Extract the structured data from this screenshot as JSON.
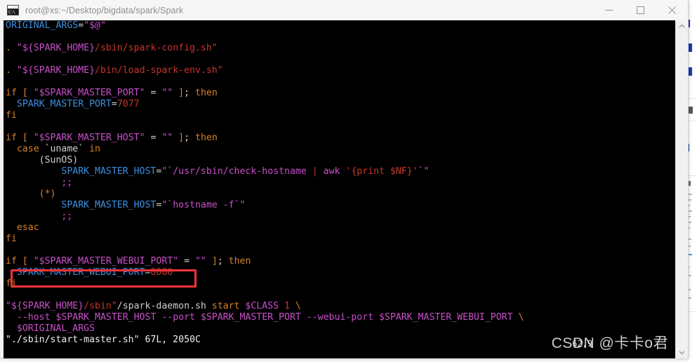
{
  "window": {
    "title": "root@xs:~/Desktop/bigdata/spark/Spark",
    "icon": "console-icon",
    "icon_text": "C:\\",
    "controls": [
      {
        "name": "minimize",
        "glyph": "minimize-icon"
      },
      {
        "name": "maximize",
        "glyph": "maximize-icon"
      },
      {
        "name": "close",
        "glyph": "close-icon"
      }
    ]
  },
  "terminal": {
    "background": "#000000",
    "editor": "vim",
    "colors": {
      "keyword": "#d8822a",
      "variable": "#c850c8",
      "string": "#c8352c",
      "identifier": "#3c8fe0",
      "plain": "#d0d0d0",
      "annotation": "#f5333a"
    },
    "lines": [
      [
        {
          "t": "ORIGINAL_ARGS",
          "c": "c-id"
        },
        {
          "t": "=",
          "c": "c-plain"
        },
        {
          "t": "\"$@\"",
          "c": "c-var"
        }
      ],
      [],
      [
        {
          "t": ". ",
          "c": "c-kw"
        },
        {
          "t": "\"${SPARK_HOME}",
          "c": "c-var"
        },
        {
          "t": "/sbin/spark-config.sh\"",
          "c": "c-str"
        }
      ],
      [],
      [
        {
          "t": ". ",
          "c": "c-kw"
        },
        {
          "t": "\"${SPARK_HOME}",
          "c": "c-var"
        },
        {
          "t": "/bin/load-spark-env.sh\"",
          "c": "c-str"
        }
      ],
      [],
      [
        {
          "t": "if ",
          "c": "c-kw"
        },
        {
          "t": "[ ",
          "c": "c-kw"
        },
        {
          "t": "\"$SPARK_MASTER_PORT\"",
          "c": "c-var"
        },
        {
          "t": " = ",
          "c": "c-plain"
        },
        {
          "t": "\"\"",
          "c": "c-var"
        },
        {
          "t": " ]",
          "c": "c-kw"
        },
        {
          "t": "; ",
          "c": "c-plain"
        },
        {
          "t": "then",
          "c": "c-kw"
        }
      ],
      [
        {
          "t": "  SPARK_MASTER_PORT",
          "c": "c-id"
        },
        {
          "t": "=",
          "c": "c-plain"
        },
        {
          "t": "7077",
          "c": "c-num"
        }
      ],
      [
        {
          "t": "fi",
          "c": "c-kw"
        }
      ],
      [],
      [
        {
          "t": "if ",
          "c": "c-kw"
        },
        {
          "t": "[ ",
          "c": "c-kw"
        },
        {
          "t": "\"$SPARK_MASTER_HOST\"",
          "c": "c-var"
        },
        {
          "t": " = ",
          "c": "c-plain"
        },
        {
          "t": "\"\"",
          "c": "c-var"
        },
        {
          "t": " ]",
          "c": "c-kw"
        },
        {
          "t": "; ",
          "c": "c-plain"
        },
        {
          "t": "then",
          "c": "c-kw"
        }
      ],
      [
        {
          "t": "  case ",
          "c": "c-kw"
        },
        {
          "t": "`uname`",
          "c": "c-plain"
        },
        {
          "t": " in",
          "c": "c-kw"
        }
      ],
      [
        {
          "t": "      (SunOS)",
          "c": "c-plain"
        }
      ],
      [
        {
          "t": "          SPARK_MASTER_HOST",
          "c": "c-id"
        },
        {
          "t": "=",
          "c": "c-plain"
        },
        {
          "t": "\"`",
          "c": "c-var"
        },
        {
          "t": "/usr/sbin/check-hostname",
          "c": "c-var"
        },
        {
          "t": " | ",
          "c": "c-str"
        },
        {
          "t": "awk ",
          "c": "c-var"
        },
        {
          "t": "'{print $NF}'",
          "c": "c-str"
        },
        {
          "t": "`\"",
          "c": "c-var"
        }
      ],
      [
        {
          "t": "          ;;",
          "c": "c-var"
        }
      ],
      [
        {
          "t": "      (*)",
          "c": "c-kw"
        }
      ],
      [
        {
          "t": "          SPARK_MASTER_HOST",
          "c": "c-id"
        },
        {
          "t": "=",
          "c": "c-plain"
        },
        {
          "t": "\"`",
          "c": "c-var"
        },
        {
          "t": "hostname -f",
          "c": "c-var"
        },
        {
          "t": "`\"",
          "c": "c-var"
        }
      ],
      [
        {
          "t": "          ;;",
          "c": "c-var"
        }
      ],
      [
        {
          "t": "  esac",
          "c": "c-kw"
        }
      ],
      [
        {
          "t": "fi",
          "c": "c-kw"
        }
      ],
      [],
      [
        {
          "t": "if ",
          "c": "c-kw"
        },
        {
          "t": "[ ",
          "c": "c-kw"
        },
        {
          "t": "\"$SPARK_MASTER_WEBUI_PORT\"",
          "c": "c-var"
        },
        {
          "t": " = ",
          "c": "c-plain"
        },
        {
          "t": "\"\"",
          "c": "c-var"
        },
        {
          "t": " ]",
          "c": "c-kw"
        },
        {
          "t": "; ",
          "c": "c-plain"
        },
        {
          "t": "then",
          "c": "c-kw"
        }
      ],
      [
        {
          "t": "  SPARK_MASTER_WEBUI_PORT",
          "c": "c-id"
        },
        {
          "t": "=",
          "c": "c-plain"
        },
        {
          "t": "8080",
          "c": "c-num"
        }
      ],
      [
        {
          "t": "fi",
          "c": "c-kw"
        }
      ],
      [],
      [
        {
          "t": "\"${SPARK_HOME}",
          "c": "c-var"
        },
        {
          "t": "/sbin\"",
          "c": "c-str"
        },
        {
          "t": "/spark-daemon.sh ",
          "c": "c-plain"
        },
        {
          "t": "start ",
          "c": "c-kw"
        },
        {
          "t": "$CLASS ",
          "c": "c-var"
        },
        {
          "t": "1 ",
          "c": "c-str"
        },
        {
          "t": "\\",
          "c": "c-kw"
        }
      ],
      [
        {
          "t": "  --host ",
          "c": "c-var"
        },
        {
          "t": "$SPARK_MASTER_HOST ",
          "c": "c-var"
        },
        {
          "t": "--port ",
          "c": "c-var"
        },
        {
          "t": "$SPARK_MASTER_PORT ",
          "c": "c-var"
        },
        {
          "t": "--webui-port ",
          "c": "c-var"
        },
        {
          "t": "$SPARK_MASTER_WEBUI_PORT ",
          "c": "c-var"
        },
        {
          "t": "\\",
          "c": "c-kw"
        }
      ],
      [
        {
          "t": "  $ORIGINAL_ARGS",
          "c": "c-var"
        }
      ],
      [
        {
          "t": "\"./sbin/start-master.sh\" 67L, 2050C",
          "c": "c-white"
        }
      ]
    ],
    "status_line": "\"./sbin/start-master.sh\" 67L, 2050C",
    "cursor_position": "62,9",
    "highlight": {
      "name": "spark-master-webui-port-highlight",
      "target_text": "SPARK_MASTER_WEBUI_PORT=8080",
      "color": "#f5333a"
    }
  },
  "watermark": {
    "text": "CSDN @卡卡o君"
  },
  "scrollbar": {
    "up_arrow": "chevron-up-icon",
    "down_arrow": "chevron-down-icon"
  }
}
